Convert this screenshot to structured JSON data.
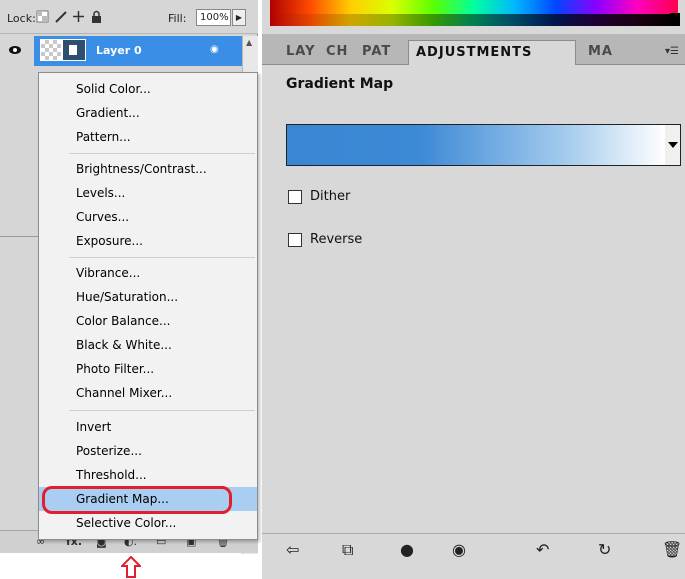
{
  "layers_panel": {
    "lock_label": "Lock:",
    "fill_label": "Fill:",
    "fill_value": "100%",
    "layer_name": "Layer 0",
    "icons": [
      "lock-transparent-icon",
      "brush-icon",
      "move-icon",
      "lock-icon",
      "eye-icon",
      "fx-icon",
      "adjustment-layer-icon"
    ]
  },
  "menu": {
    "items": [
      "Solid Color...",
      "Gradient...",
      "Pattern...",
      "Brightness/Contrast...",
      "Levels...",
      "Curves...",
      "Exposure...",
      "Vibrance...",
      "Hue/Saturation...",
      "Color Balance...",
      "Black & White...",
      "Photo Filter...",
      "Channel Mixer...",
      "Invert",
      "Posterize...",
      "Threshold...",
      "Gradient Map...",
      "Selective Color..."
    ],
    "highlighted": "Gradient Map..."
  },
  "adjustments_panel": {
    "tabs": [
      "LAY",
      "CH",
      "PAT",
      "ADJUSTMENTS",
      "MA"
    ],
    "active_tab": "ADJUSTMENTS",
    "title": "Gradient Map",
    "gradient_colors": [
      "#3a86d4",
      "#ffffff"
    ],
    "dither_label": "Dither",
    "reverse_label": "Reverse"
  },
  "colors": {
    "selection_blue": "#3a8ee6",
    "menu_highlight": "#a9cef2",
    "annotation_red": "#e21f2a"
  }
}
